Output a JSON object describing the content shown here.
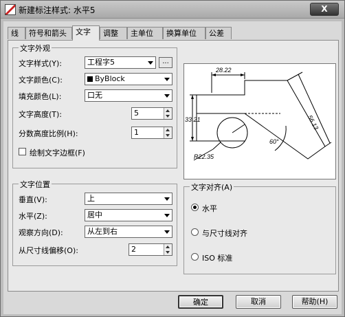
{
  "window": {
    "title": "新建标注样式: 水平5",
    "close_label": "X"
  },
  "tabs": [
    "线",
    "符号和箭头",
    "文字",
    "调整",
    "主单位",
    "换算单位",
    "公差"
  ],
  "active_tab": 2,
  "text_appearance": {
    "legend": "文字外观",
    "style_label": "文字样式(Y):",
    "style_value": "工程字5",
    "style_more": "...",
    "color_label": "文字颜色(C):",
    "color_value": "ByBlock",
    "fill_label": "填充颜色(L):",
    "fill_value": "口无",
    "height_label": "文字高度(T):",
    "height_value": "5",
    "fraction_label": "分数高度比例(H):",
    "fraction_value": "1",
    "frame_label": "绘制文字边框(F)",
    "frame_checked": false
  },
  "text_placement": {
    "legend": "文字位置",
    "vertical_label": "垂直(V):",
    "vertical_value": "上",
    "horizontal_label": "水平(Z):",
    "horizontal_value": "居中",
    "direction_label": "观察方向(D):",
    "direction_value": "从左到右",
    "offset_label": "从尺寸线偏移(O):",
    "offset_value": "2"
  },
  "text_alignment": {
    "legend": "文字对齐(A)",
    "options": [
      "水平",
      "与尺寸线对齐",
      "ISO 标准"
    ],
    "selected": 0
  },
  "preview": {
    "dims": [
      "28.22",
      "33.21",
      "56.13",
      "60°",
      "R22.35"
    ]
  },
  "buttons": {
    "ok": "确定",
    "cancel": "取消",
    "help": "帮助(H)"
  },
  "colors": {
    "bylock_swatch": "#000000"
  }
}
